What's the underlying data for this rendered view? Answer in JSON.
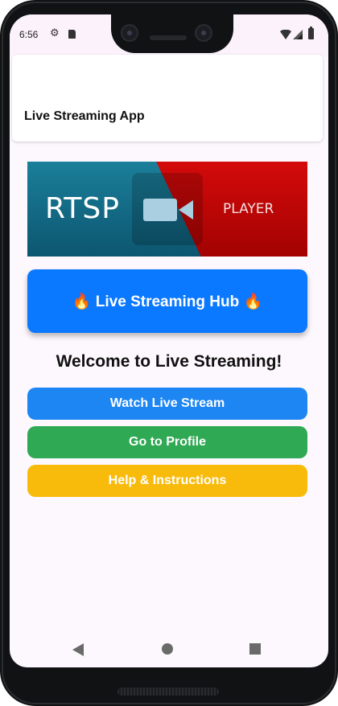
{
  "status_bar": {
    "time": "6:56",
    "icons": [
      "settings-icon",
      "sd-card-icon",
      "wifi-icon",
      "signal-icon",
      "battery-icon"
    ]
  },
  "app_header": {
    "title": "Live Streaming App"
  },
  "banner": {
    "left_text": "RTSP",
    "right_text": "PLAYER",
    "colors": {
      "left": "#0c5670",
      "right": "#c40606",
      "camera": "#a9cfe1"
    }
  },
  "hub": {
    "label": "🔥 Live Streaming Hub 🔥",
    "color": "#0a78ff"
  },
  "welcome": {
    "heading": "Welcome to Live Streaming!"
  },
  "buttons": [
    {
      "label": "Watch Live Stream",
      "color": "#1d86f3"
    },
    {
      "label": "Go to Profile",
      "color": "#2fa954"
    },
    {
      "label": "Help & Instructions",
      "color": "#f8bb0c"
    }
  ],
  "nav_bar": {
    "icons": [
      "back-icon",
      "home-icon",
      "recents-icon"
    ]
  }
}
